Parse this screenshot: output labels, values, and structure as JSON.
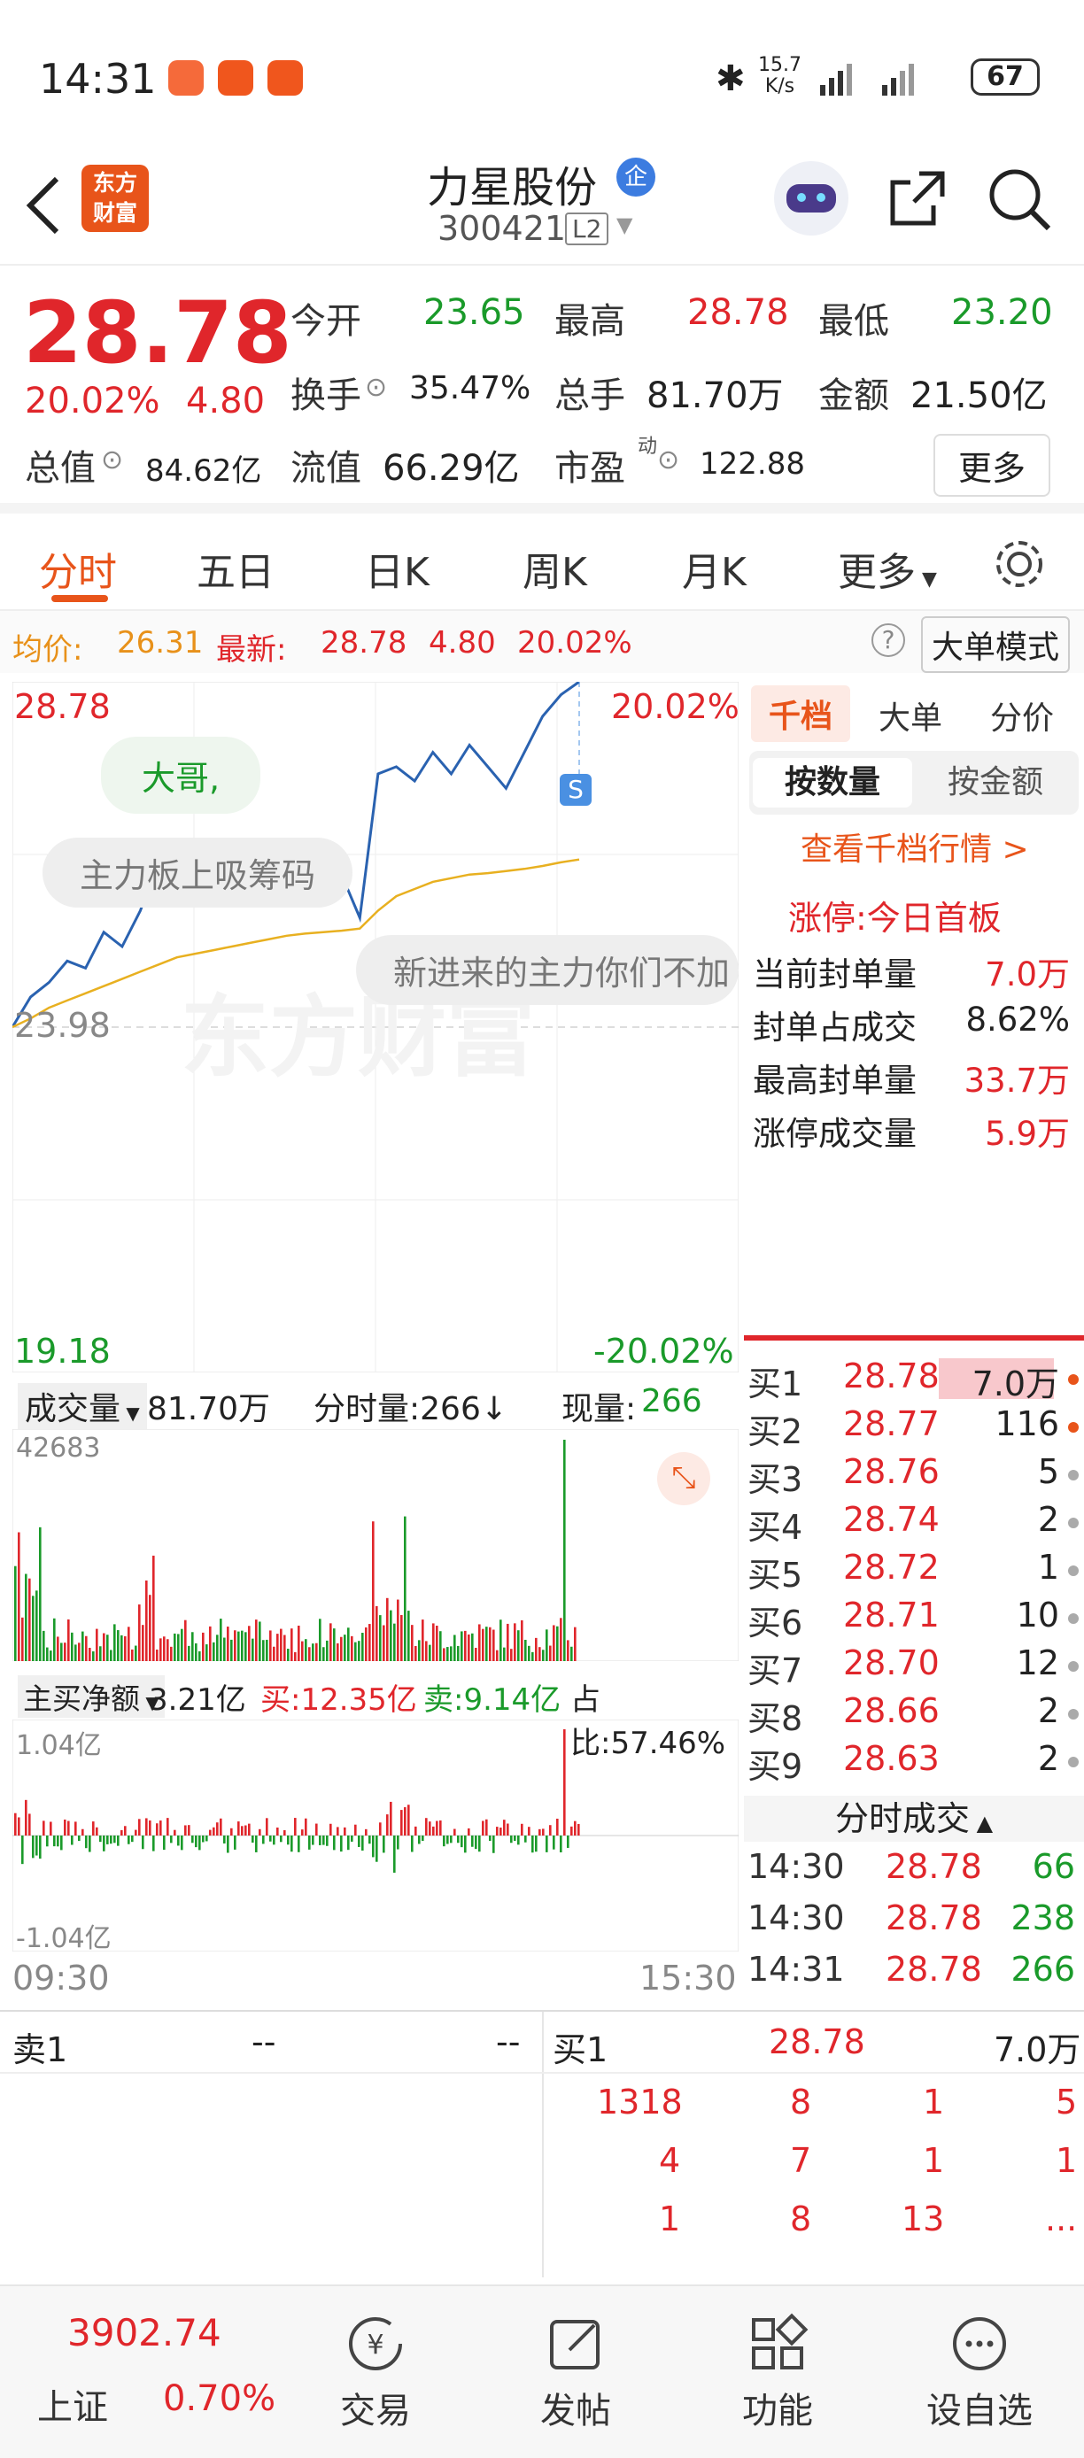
{
  "status": {
    "time": "14:31",
    "net_speed_top": "15.7",
    "net_speed_bottom": "K/s",
    "battery": "67",
    "app_icons": [
      "video-app-icon",
      "news-app-icon",
      "news-app-icon-2"
    ]
  },
  "header": {
    "logo_line1": "东方",
    "logo_line2": "财富",
    "title": "力星股份",
    "badge": "企",
    "code": "300421",
    "level": "L2"
  },
  "quote": {
    "price": "28.78",
    "change_pct": "20.02%",
    "change_abs": "4.80",
    "open_label": "今开",
    "open": "23.65",
    "high_label": "最高",
    "high": "28.78",
    "low_label": "最低",
    "low": "23.20",
    "turnover_label": "换手",
    "turnover": "35.47%",
    "volume_label": "总手",
    "volume": "81.70万",
    "amount_label": "金额",
    "amount": "21.50亿",
    "mktcap_label": "总值",
    "mktcap": "84.62亿",
    "float_label": "流值",
    "float_val": "66.29亿",
    "pe_label": "市盈",
    "pe_sup": "动",
    "pe": "122.88",
    "more_btn": "更多"
  },
  "tabs": {
    "items": [
      "分时",
      "五日",
      "日K",
      "周K",
      "月K",
      "更多"
    ],
    "active": "分时"
  },
  "avgbar": {
    "avg_label": "均价:",
    "avg": "26.31",
    "latest_label": "最新:",
    "latest": "28.78",
    "chg": "4.80",
    "pct": "20.02%",
    "mode_btn": "大单模式"
  },
  "chart": {
    "y_top": "28.78",
    "y_top_pct": "20.02%",
    "y_mid": "23.98",
    "y_bottom": "19.18",
    "y_bottom_pct": "-20.02%",
    "watermark": "东方财富",
    "comment_1": "大哥,",
    "comment_2": "主力板上吸筹码",
    "comment_3": "新进来的主力你们不加",
    "marker": "S",
    "vol_label": "成交量",
    "vol_total": "81.70万",
    "vol_minute": "分时量:266↓",
    "vol_now_label": "现量:",
    "vol_now": "266",
    "vol_max": "42683",
    "flow_label": "主买净额",
    "flow_net": "3.21亿",
    "flow_buy": "买:12.35亿",
    "flow_sell": "卖:9.14亿",
    "flow_ratio": "占比:57.46%",
    "flow_top": "1.04亿",
    "flow_bottom": "-1.04亿",
    "time_start": "09:30",
    "time_end": "15:30"
  },
  "chart_data": {
    "type": "line",
    "title": "",
    "series": [
      {
        "values": [
          23.98,
          24.4,
          24.6,
          24.9,
          24.8,
          25.3,
          25.1,
          25.6,
          26.3,
          25.8,
          25.9,
          26.0,
          25.7,
          25.9,
          26.1,
          26.3,
          25.8,
          26.2,
          26.1,
          25.5,
          27.5,
          27.6,
          27.4,
          27.8,
          27.5,
          27.9,
          27.6,
          27.3,
          27.8,
          28.3,
          28.6,
          28.78
        ]
      },
      {
        "values": [
          23.98,
          24.1,
          24.25,
          24.35,
          24.45,
          24.55,
          24.65,
          24.75,
          24.85,
          24.95,
          25.0,
          25.05,
          25.1,
          25.15,
          25.2,
          25.25,
          25.28,
          25.3,
          25.32,
          25.35,
          25.6,
          25.8,
          25.9,
          26.0,
          26.05,
          26.1,
          26.12,
          26.15,
          26.18,
          26.22,
          26.27,
          26.31
        ]
      }
    ],
    "ylim": [
      19.18,
      28.78
    ]
  },
  "rpanel": {
    "tabs": [
      "千档",
      "大单",
      "分价"
    ],
    "seg_on": "按数量",
    "seg_off": "按金额",
    "link": "查看千档行情 >",
    "limit_title": "涨停:今日首板",
    "rows": [
      {
        "label": "当前封单量",
        "value": "7.0万"
      },
      {
        "label": "封单占成交",
        "value": "8.62%"
      },
      {
        "label": "最高封单量",
        "value": "33.7万"
      },
      {
        "label": "涨停成交量",
        "value": "5.9万"
      }
    ],
    "bids": [
      {
        "label": "买1",
        "price": "28.78",
        "qty": "7.0万"
      },
      {
        "label": "买2",
        "price": "28.77",
        "qty": "116"
      },
      {
        "label": "买3",
        "price": "28.76",
        "qty": "5"
      },
      {
        "label": "买4",
        "price": "28.74",
        "qty": "2"
      },
      {
        "label": "买5",
        "price": "28.72",
        "qty": "1"
      },
      {
        "label": "买6",
        "price": "28.71",
        "qty": "10"
      },
      {
        "label": "买7",
        "price": "28.70",
        "qty": "12"
      },
      {
        "label": "买8",
        "price": "28.66",
        "qty": "2"
      },
      {
        "label": "买9",
        "price": "28.63",
        "qty": "2"
      }
    ],
    "ticks_title": "分时成交",
    "ticks": [
      {
        "time": "14:30",
        "price": "28.78",
        "vol": "66"
      },
      {
        "time": "14:30",
        "price": "28.78",
        "vol": "238"
      },
      {
        "time": "14:31",
        "price": "28.78",
        "vol": "266"
      }
    ]
  },
  "orders": {
    "sell_label": "卖1",
    "sell_price": "--",
    "sell_qty": "--",
    "buy_label": "买1",
    "buy_price": "28.78",
    "buy_qty": "7.0万",
    "grid": [
      [
        "1318",
        "8",
        "1",
        "5"
      ],
      [
        "4",
        "7",
        "1",
        "1"
      ],
      [
        "1",
        "8",
        "13",
        "..."
      ]
    ]
  },
  "bottomnav": {
    "index_value": "3902.74",
    "index_name": "上证",
    "index_pct": "0.70%",
    "items": [
      "交易",
      "发帖",
      "功能",
      "设自选"
    ]
  },
  "colors": {
    "up": "#e0262b",
    "down": "#1a9a2a",
    "accent": "#e8541a",
    "avg_line": "#e8b020",
    "price_line": "#2a62b0"
  }
}
